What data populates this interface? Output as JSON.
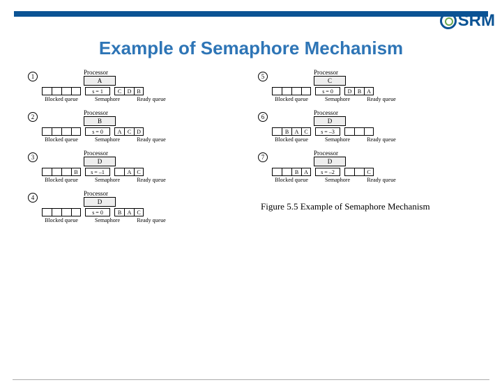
{
  "logo_text": "SRM",
  "title": "Example of Semaphore Mechanism",
  "labels": {
    "processor": "Processor",
    "blocked": "Blocked queue",
    "semaphore": "Semaphore",
    "ready": "Ready queue"
  },
  "caption": "Figure 5.5   Example of Semaphore Mechanism",
  "states": [
    {
      "n": "1",
      "proc": "A",
      "blocked": [
        "",
        "",
        "",
        ""
      ],
      "s": "s = 1",
      "ready": [
        "C",
        "D",
        "B"
      ]
    },
    {
      "n": "2",
      "proc": "B",
      "blocked": [
        "",
        "",
        "",
        ""
      ],
      "s": "s = 0",
      "ready": [
        "A",
        "C",
        "D"
      ]
    },
    {
      "n": "3",
      "proc": "D",
      "blocked": [
        "",
        "",
        "",
        "B"
      ],
      "s": "s = –1",
      "ready": [
        "",
        "A",
        "C"
      ]
    },
    {
      "n": "4",
      "proc": "D",
      "blocked": [
        "",
        "",
        "",
        ""
      ],
      "s": "s = 0",
      "ready": [
        "B",
        "A",
        "C"
      ]
    },
    {
      "n": "5",
      "proc": "C",
      "blocked": [
        "",
        "",
        "",
        ""
      ],
      "s": "s = 0",
      "ready": [
        "D",
        "B",
        "A"
      ]
    },
    {
      "n": "6",
      "proc": "D",
      "blocked": [
        "",
        "B",
        "A",
        "C"
      ],
      "s": "s = –3",
      "ready": [
        "",
        "",
        ""
      ]
    },
    {
      "n": "7",
      "proc": "D",
      "blocked": [
        "",
        "",
        "B",
        "A"
      ],
      "s": "s = –2",
      "ready": [
        "",
        "",
        "C"
      ]
    }
  ]
}
